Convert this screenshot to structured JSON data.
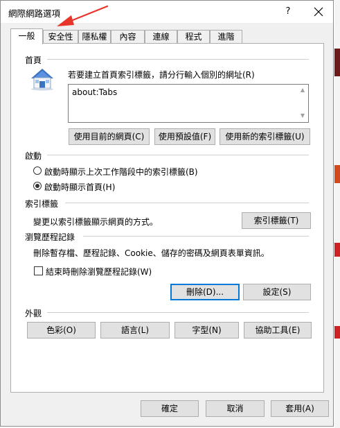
{
  "window": {
    "title": "網際網路選項",
    "help_label": "?",
    "close_label": "✕"
  },
  "tabs": [
    {
      "label": "一般",
      "active": true
    },
    {
      "label": "安全性"
    },
    {
      "label": "隱私權"
    },
    {
      "label": "內容"
    },
    {
      "label": "連線"
    },
    {
      "label": "程式"
    },
    {
      "label": "進階"
    }
  ],
  "home": {
    "section_label": "首頁",
    "icon": "house-icon",
    "description": "若要建立首頁索引標籤，請分行輸入個別的網址(R)",
    "url_value": "about:Tabs",
    "btn_current": "使用目前的網頁(C)",
    "btn_default": "使用預設值(F)",
    "btn_new_tab": "使用新的索引標籤(U)"
  },
  "startup": {
    "section_label": "啟動",
    "option_tabs": "啟動時顯示上次工作階段中的索引標籤(B)",
    "option_home": "啟動時顯示首頁(H)",
    "selected": "home"
  },
  "tabs_section": {
    "section_label": "索引標籤",
    "description": "變更以索引標籤顯示網頁的方式。",
    "button": "索引標籤(T)"
  },
  "history": {
    "section_label": "瀏覽歷程記錄",
    "description": "刪除暫存檔、歷程記錄、Cookie、儲存的密碼及網頁表單資訊。",
    "checkbox_label": "結束時刪除瀏覽歷程記錄(W)",
    "checkbox_checked": false,
    "delete_button": "刪除(D)...",
    "settings_button": "設定(S)"
  },
  "appearance": {
    "section_label": "外觀",
    "colors": "色彩(O)",
    "languages": "語言(L)",
    "fonts": "字型(N)",
    "accessibility": "協助工具(E)"
  },
  "footer": {
    "ok": "確定",
    "cancel": "取消",
    "apply": "套用(A)"
  },
  "colors": {
    "accent": "#0078d7",
    "annotation_arrow": "#e8352a"
  }
}
